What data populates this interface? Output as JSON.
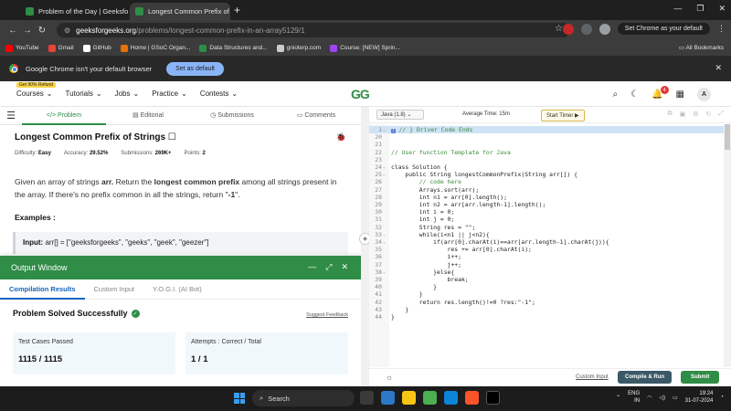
{
  "browser": {
    "tabs": [
      {
        "title": "Problem of the Day | GeeksforGeeks",
        "active": false
      },
      {
        "title": "Longest Common Prefix of Strings",
        "active": true
      }
    ],
    "new_tab": "+",
    "url_host": "geeksforgeeks.org",
    "url_path": "/problems/longest-common-prefix-in-an-array5129/1",
    "set_chrome_label": "Set Chrome as your default",
    "bookmarks": [
      {
        "label": "YouTube",
        "color": "#ff0000"
      },
      {
        "label": "Gmail",
        "color": "#ea4335"
      },
      {
        "label": "GitHub",
        "color": "#ffffff"
      },
      {
        "label": "Home | GSoC Organ...",
        "color": "#e8710a"
      },
      {
        "label": "Data Structures and...",
        "color": "#2f8d46"
      },
      {
        "label": "gnioterp.com",
        "color": "#cccccc"
      },
      {
        "label": "Course: [NEW] Sprin...",
        "color": "#a142f4"
      }
    ],
    "all_bookmarks": "All Bookmarks",
    "infobar_text": "Google Chrome isn't your default browser",
    "infobar_button": "Set as default"
  },
  "gfg_nav": {
    "refund_badge": "Get 90% Refund",
    "menu": [
      "Courses",
      "Tutorials",
      "Jobs",
      "Practice",
      "Contests"
    ],
    "logo": "GG",
    "notif_count": "4",
    "avatar": "A"
  },
  "problem": {
    "tabs": [
      "Problem",
      "Editorial",
      "Submissions",
      "Comments"
    ],
    "title": "Longest Common Prefix of Strings",
    "difficulty_label": "Difficulty:",
    "difficulty": "Easy",
    "accuracy_label": "Accuracy:",
    "accuracy": "29.52%",
    "submissions_label": "Submissions:",
    "submissions": "269K+",
    "points_label": "Points:",
    "points": "2",
    "desc_1": "Given an array of strings ",
    "desc_arr": "arr.",
    "desc_2": " Return the ",
    "desc_bold": "longest common prefix",
    "desc_3": " among all strings present in the array. If there's no prefix common in all the strings, return \"",
    "desc_neg": "-1",
    "desc_4": "\".",
    "examples": "Examples :",
    "input_label": "Input:",
    "input_value": " arr[] = [\"geeksforgeeks\", \"geeks\", \"geek\", \"geezer\"]"
  },
  "output": {
    "title": "Output Window",
    "tabs": [
      "Compilation Results",
      "Custom Input",
      "Y.O.G.I. (AI Bot)"
    ],
    "solved": "Problem Solved Successfully",
    "feedback": "Suggest Feedback",
    "test_label": "Test Cases Passed",
    "test_value": "1115 / 1115",
    "attempts_label": "Attempts : Correct / Total",
    "attempts_value": "1 / 1"
  },
  "editor": {
    "language": "Java (1.8)",
    "avg_time": "Average Time: 15m",
    "start_timer": "Start Timer",
    "lines": [
      {
        "n": "1",
        "fold": true,
        "hl": true,
        "tag": "}",
        "text": "// } Driver Code Ends"
      },
      {
        "n": "20",
        "text": ""
      },
      {
        "n": "21",
        "text": ""
      },
      {
        "n": "22",
        "text": "// User function Template for Java"
      },
      {
        "n": "23",
        "text": ""
      },
      {
        "n": "24",
        "fold": true,
        "text": "class Solution {"
      },
      {
        "n": "25",
        "fold": true,
        "text": "    public String longestCommonPrefix(String arr[]) {"
      },
      {
        "n": "26",
        "text": "        // code here"
      },
      {
        "n": "27",
        "text": "        Arrays.sort(arr);"
      },
      {
        "n": "28",
        "text": "        int n1 = arr[0].length();"
      },
      {
        "n": "29",
        "text": "        int n2 = arr[arr.length-1].length();"
      },
      {
        "n": "30",
        "text": "        int i = 0;"
      },
      {
        "n": "31",
        "text": "        int j = 0;"
      },
      {
        "n": "32",
        "text": "        String res = \"\";"
      },
      {
        "n": "33",
        "fold": true,
        "text": "        while(i<n1 || j<n2){"
      },
      {
        "n": "34",
        "fold": true,
        "text": "            if(arr[0].charAt(i)==arr[arr.length-1].charAt(j)){"
      },
      {
        "n": "35",
        "text": "                res += arr[0].charAt(i);"
      },
      {
        "n": "36",
        "text": "                i++;"
      },
      {
        "n": "37",
        "text": "                j++;"
      },
      {
        "n": "38",
        "fold": true,
        "text": "            }else{"
      },
      {
        "n": "39",
        "text": "                break;"
      },
      {
        "n": "40",
        "text": "            }"
      },
      {
        "n": "41",
        "text": "        }"
      },
      {
        "n": "42",
        "text": "        return res.length()!=0 ?res:\"-1\";"
      },
      {
        "n": "43",
        "text": "    }"
      },
      {
        "n": "44",
        "text": "}"
      }
    ],
    "custom_input": "Custom Input",
    "compile_run": "Compile & Run",
    "submit": "Submit"
  },
  "taskbar": {
    "search": "Search",
    "lang_1": "ENG",
    "lang_2": "IN",
    "time": "19:24",
    "date": "31-07-2024"
  },
  "colors": {
    "gfg_green": "#2f8d46",
    "link_blue": "#1565c0"
  }
}
